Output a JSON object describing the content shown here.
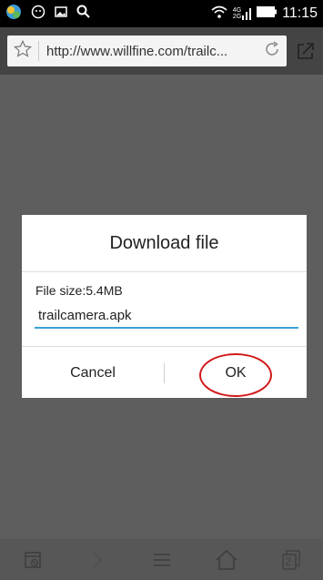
{
  "status_bar": {
    "time": "11:15",
    "network_top": "4G",
    "network_bottom": "2G",
    "icons": [
      "app-icon",
      "chat-icon",
      "image-icon",
      "search-icon",
      "wifi-icon",
      "signal-icon",
      "battery-icon"
    ]
  },
  "browser": {
    "url": "http://www.willfine.com/trailc...",
    "icons": [
      "star-icon",
      "refresh-icon",
      "share-icon"
    ]
  },
  "dialog": {
    "title": "Download file",
    "file_size": "File size:5.4MB",
    "filename": "trailcamera.apk",
    "cancel_label": "Cancel",
    "ok_label": "OK",
    "annotation_color": "#d21a1a"
  },
  "toolbar": {
    "tab_count": "2",
    "icons": [
      "close-tabs-icon",
      "forward-icon",
      "menu-icon",
      "home-icon",
      "tabs-icon"
    ]
  },
  "colors": {
    "status_bar_bg": "#000000",
    "address_bar_bg": "#444444",
    "accent": "#3aa0d8"
  }
}
